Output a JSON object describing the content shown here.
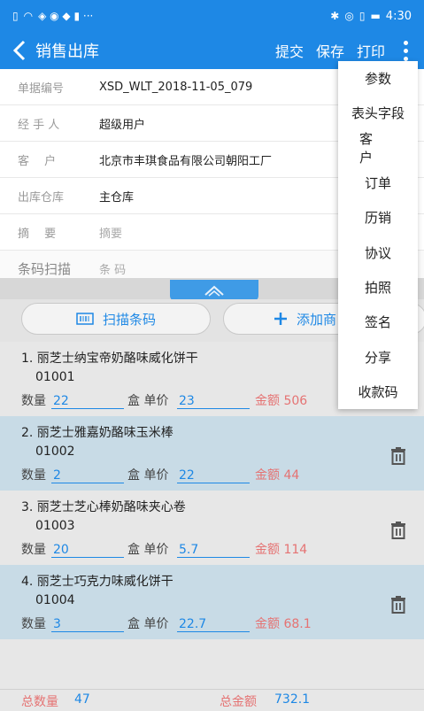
{
  "status_bar": {
    "time": "4:30",
    "left_icons": [
      "sim-icon",
      "wifi-icon",
      "notification-icon"
    ],
    "right_icons": [
      "bluetooth-icon",
      "location-icon",
      "vibrate-icon",
      "battery-icon"
    ]
  },
  "app_bar": {
    "title": "销售出库",
    "submit": "提交",
    "save": "保存",
    "print": "打印"
  },
  "form": {
    "order_no": {
      "label": "单据编号",
      "value": "XSD_WLT_2018-11-05_079"
    },
    "handler": {
      "label": "经 手 人",
      "value": "超级用户"
    },
    "customer": {
      "label": "客　 户",
      "value": "北京市丰琪食品有限公司朝阳工厂"
    },
    "warehouse": {
      "label": "出库仓库",
      "value": "主仓库"
    },
    "summary": {
      "label": "摘　 要",
      "placeholder": "摘要"
    },
    "barcode": {
      "label": "条码扫描",
      "placeholder": "条 码"
    }
  },
  "buttons": {
    "scan": "扫描条码",
    "add": "添加商"
  },
  "items": [
    {
      "name": "1.  丽芝士纳宝帝奶酪味威化饼干",
      "code": "01001",
      "qty_label": "数量",
      "qty": "22",
      "unit": "盒 单价",
      "price": "23",
      "amount": "金额 506",
      "selected": false
    },
    {
      "name": "2.  丽芝士雅嘉奶酪味玉米棒",
      "code": "01002",
      "qty_label": "数量",
      "qty": "2",
      "unit": "盒 单价",
      "price": "22",
      "amount": "金额 44",
      "selected": true
    },
    {
      "name": "3.  丽芝士芝心棒奶酪味夹心卷",
      "code": "01003",
      "qty_label": "数量",
      "qty": "20",
      "unit": "盒 单价",
      "price": "5.7",
      "amount": "金额 114",
      "selected": false
    },
    {
      "name": "4.  丽芝士巧克力味威化饼干",
      "code": "01004",
      "qty_label": "数量",
      "qty": "3",
      "unit": "盒 单价",
      "price": "22.7",
      "amount": "金额 68.1",
      "selected": true
    }
  ],
  "footer": {
    "total_qty_label": "总数量",
    "total_qty": "47",
    "total_amount_label": "总金额",
    "total_amount": "732.1"
  },
  "menu": [
    "参数",
    "表头字段",
    "客户",
    "订单",
    "历销",
    "协议",
    "拍照",
    "签名",
    "分享",
    "收款码"
  ],
  "colors": {
    "primary": "#1e88e5",
    "amount": "#e57373",
    "selected_row": "#c8dbe6"
  }
}
